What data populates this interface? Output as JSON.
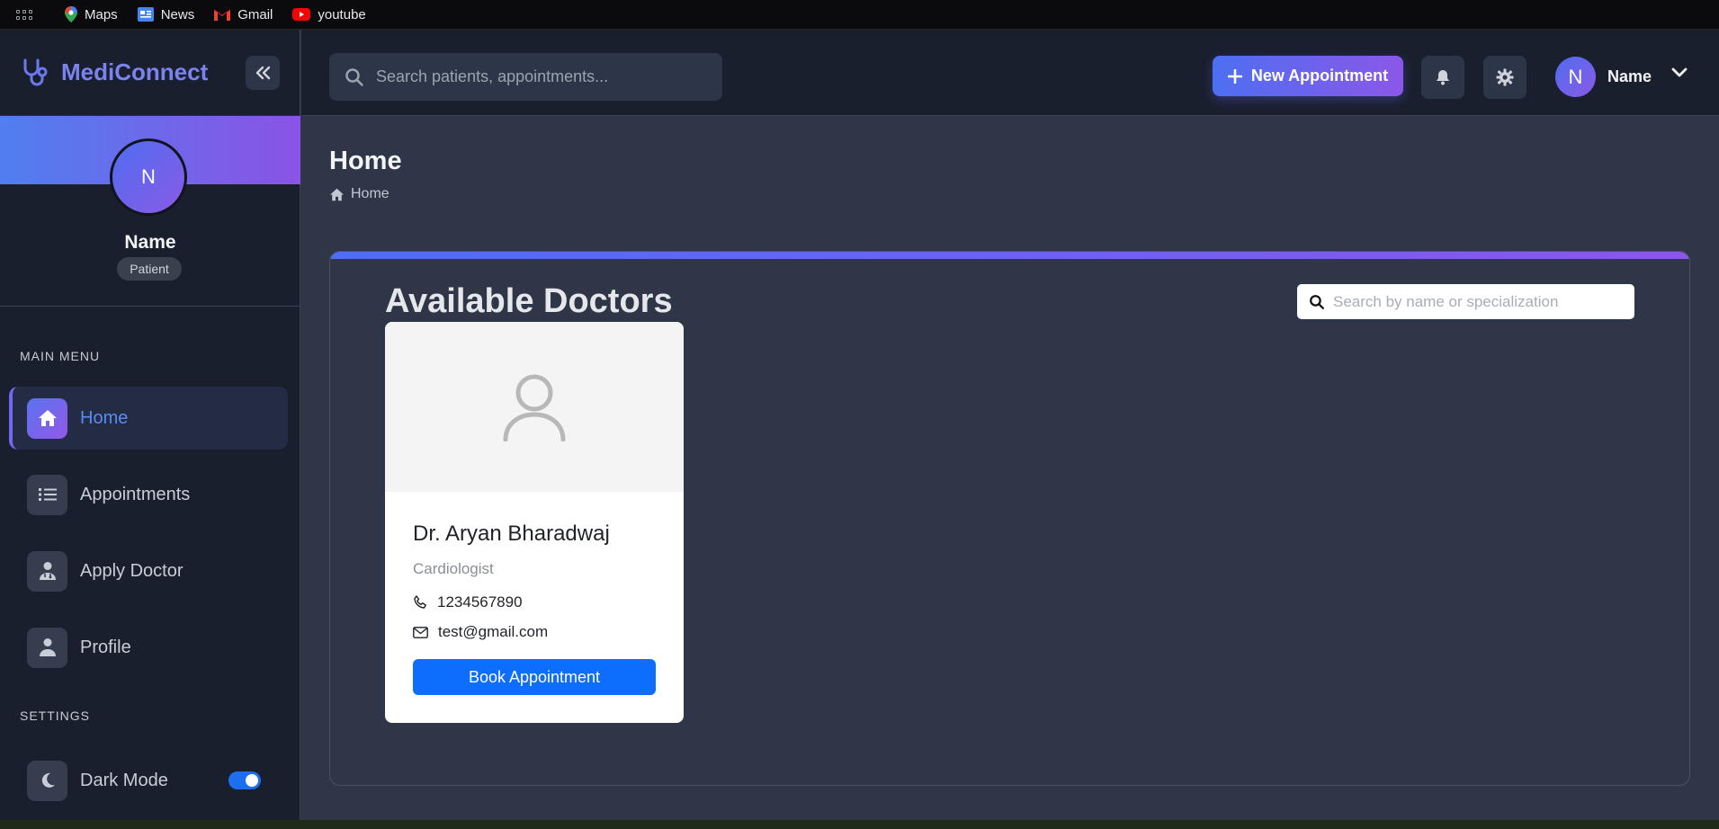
{
  "bookmarks": [
    {
      "label": "Maps",
      "icon": "maps-pin-icon"
    },
    {
      "label": "News",
      "icon": "news-icon"
    },
    {
      "label": "Gmail",
      "icon": "gmail-icon"
    },
    {
      "label": "youtube",
      "icon": "youtube-icon"
    }
  ],
  "brand": {
    "name": "MediConnect",
    "icon": "stethoscope-icon"
  },
  "profile": {
    "initial": "N",
    "name": "Name",
    "role": "Patient"
  },
  "sidebar": {
    "main_heading": "MAIN MENU",
    "items": [
      {
        "label": "Home",
        "icon": "home-icon",
        "active": true
      },
      {
        "label": "Appointments",
        "icon": "list-icon",
        "active": false
      },
      {
        "label": "Apply Doctor",
        "icon": "doctor-icon",
        "active": false
      },
      {
        "label": "Profile",
        "icon": "user-icon",
        "active": false
      }
    ],
    "settings_heading": "SETTINGS",
    "dark_mode": {
      "label": "Dark Mode",
      "icon": "moon-icon",
      "enabled": true
    }
  },
  "header": {
    "search_placeholder": "Search patients, appointments...",
    "new_appointment_label": "New Appointment",
    "user_initial": "N",
    "user_name": "Name"
  },
  "page": {
    "title": "Home",
    "breadcrumb": "Home"
  },
  "doctors_panel": {
    "title": "Available Doctors",
    "search_placeholder": "Search by name or specialization",
    "doctors": [
      {
        "name": "Dr. Aryan Bharadwaj",
        "specialization": "Cardiologist",
        "phone": "1234567890",
        "email": "test@gmail.com",
        "book_label": "Book Appointment"
      }
    ]
  },
  "colors": {
    "accent_start": "#4d6ff1",
    "accent_end": "#8b57e8",
    "primary_button": "#0d6efd",
    "sidebar_bg": "#1a1f2e",
    "main_bg": "#2e3648"
  }
}
